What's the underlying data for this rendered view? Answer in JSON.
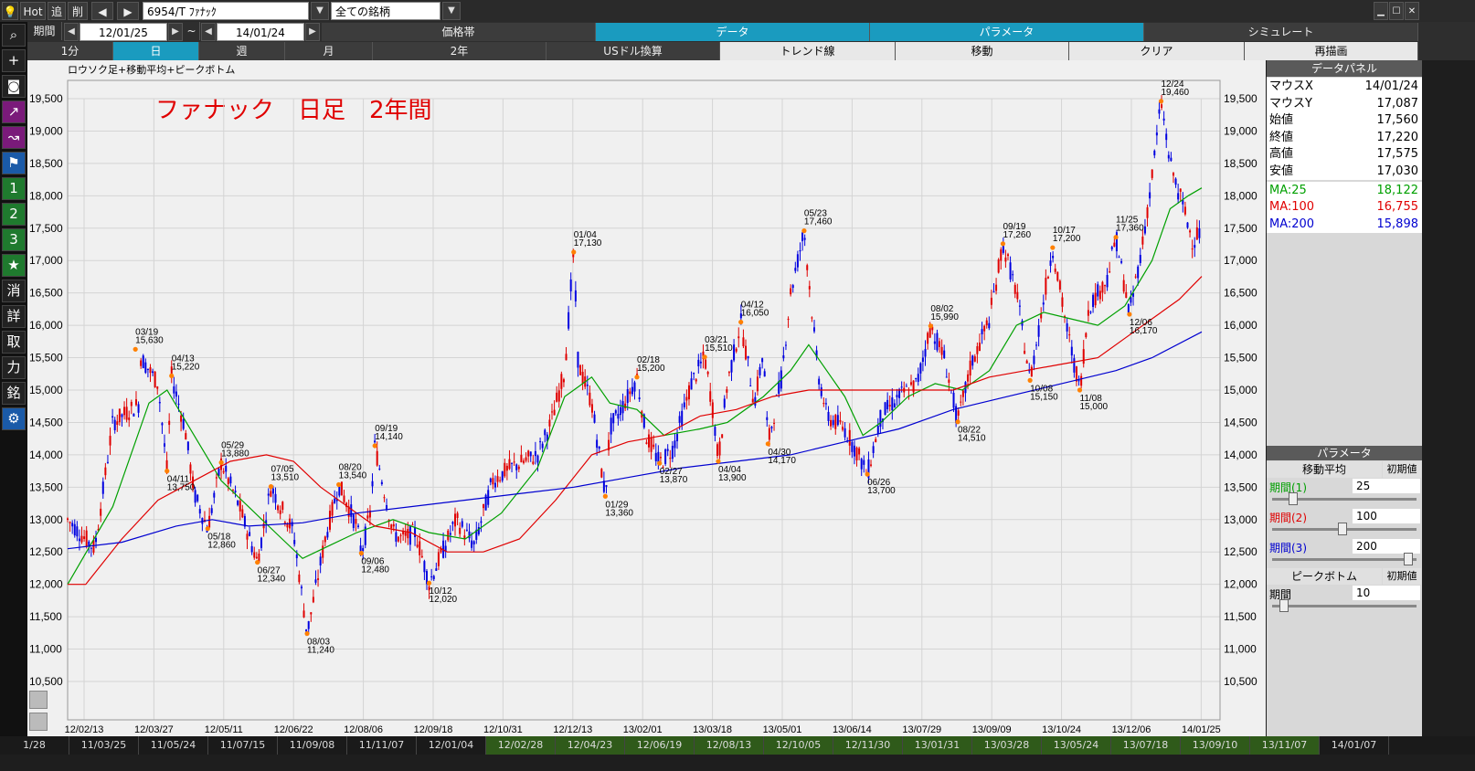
{
  "toolbar": {
    "hot_label": "Hot",
    "add_label": "追",
    "del_label": "削",
    "symbol_value": "6954/T ﾌｧﾅｯｸ",
    "universe_value": "全ての銘柄",
    "window_buttons": [
      "▁",
      "☐",
      "✕"
    ]
  },
  "period": {
    "label": "期間",
    "from": "12/01/25",
    "tilde": "~",
    "to": "14/01/24"
  },
  "mode_tabs": [
    {
      "label": "価格帯"
    },
    {
      "label": "データ"
    },
    {
      "label": "パラメータ"
    },
    {
      "label": "シミュレート"
    }
  ],
  "range_tabs": [
    {
      "label": "1分"
    },
    {
      "label": "日"
    },
    {
      "label": "週"
    },
    {
      "label": "月"
    },
    {
      "label": "2年"
    },
    {
      "label": "USドル換算"
    },
    {
      "label": "トレンド線"
    },
    {
      "label": "移動"
    },
    {
      "label": "クリア"
    },
    {
      "label": "再描画"
    }
  ],
  "left_tools": [
    "search-icon",
    "plus-icon",
    "camera-icon",
    "chart-line-icon",
    "chart-multi-icon",
    "flag-icon",
    "1",
    "2",
    "3",
    "★",
    "消",
    "詳",
    "取",
    "力",
    "銘",
    "gear-icon"
  ],
  "chart": {
    "subtitle": "ロウソク足+移動平均+ピークボトム",
    "title": "ファナック　日足　2年間"
  },
  "chart_data": {
    "type": "candlestick",
    "ylim": [
      10500,
      19500
    ],
    "yticks": [
      10500,
      11000,
      11500,
      12000,
      12500,
      13000,
      13500,
      14000,
      14500,
      15000,
      15500,
      16000,
      16500,
      17000,
      17500,
      18000,
      18500,
      19000,
      19500
    ],
    "ytick_labels": [
      "10,500",
      "11,000",
      "11,500",
      "12,000",
      "12,500",
      "13,000",
      "13,500",
      "14,000",
      "14,500",
      "15,000",
      "15,500",
      "16,000",
      "16,500",
      "17,000",
      "17,500",
      "18,000",
      "18,500",
      "19,000",
      "19,500"
    ],
    "xtick_labels": [
      "12/02/13",
      "12/03/27",
      "12/05/11",
      "12/06/22",
      "12/08/06",
      "12/09/18",
      "12/10/31",
      "12/12/13",
      "13/02/01",
      "13/03/18",
      "13/05/01",
      "13/06/14",
      "13/07/29",
      "13/09/09",
      "13/10/24",
      "13/12/06",
      "14/01/25"
    ],
    "price_path": [
      [
        0,
        13000
      ],
      [
        0.03,
        12550
      ],
      [
        0.05,
        14500
      ],
      [
        0.08,
        14800
      ],
      [
        0.075,
        15630
      ],
      [
        0.1,
        15100
      ],
      [
        0.11,
        13750
      ],
      [
        0.115,
        15220
      ],
      [
        0.13,
        14400
      ],
      [
        0.14,
        13400
      ],
      [
        0.155,
        12860
      ],
      [
        0.17,
        13880
      ],
      [
        0.19,
        13200
      ],
      [
        0.21,
        12340
      ],
      [
        0.225,
        13510
      ],
      [
        0.25,
        12800
      ],
      [
        0.265,
        11240
      ],
      [
        0.285,
        12700
      ],
      [
        0.3,
        13540
      ],
      [
        0.32,
        12900
      ],
      [
        0.325,
        12480
      ],
      [
        0.335,
        13100
      ],
      [
        0.34,
        14140
      ],
      [
        0.36,
        12800
      ],
      [
        0.37,
        12700
      ],
      [
        0.385,
        12800
      ],
      [
        0.4,
        12020
      ],
      [
        0.43,
        13000
      ],
      [
        0.45,
        12600
      ],
      [
        0.47,
        13600
      ],
      [
        0.49,
        13800
      ],
      [
        0.52,
        14000
      ],
      [
        0.535,
        14500
      ],
      [
        0.55,
        15300
      ],
      [
        0.56,
        17130
      ],
      [
        0.565,
        15400
      ],
      [
        0.58,
        14800
      ],
      [
        0.595,
        13360
      ],
      [
        0.6,
        14400
      ],
      [
        0.62,
        14900
      ],
      [
        0.63,
        15200
      ],
      [
        0.64,
        14300
      ],
      [
        0.655,
        13870
      ],
      [
        0.67,
        14100
      ],
      [
        0.69,
        15100
      ],
      [
        0.705,
        15510
      ],
      [
        0.715,
        14600
      ],
      [
        0.72,
        13900
      ],
      [
        0.73,
        15100
      ],
      [
        0.745,
        16050
      ],
      [
        0.76,
        14800
      ],
      [
        0.77,
        15600
      ],
      [
        0.775,
        14170
      ],
      [
        0.79,
        15200
      ],
      [
        0.8,
        16500
      ],
      [
        0.815,
        17460
      ],
      [
        0.83,
        15300
      ],
      [
        0.84,
        14600
      ],
      [
        0.86,
        14400
      ],
      [
        0.875,
        14000
      ],
      [
        0.885,
        13700
      ],
      [
        0.9,
        14600
      ],
      [
        0.92,
        14900
      ],
      [
        0.94,
        15100
      ],
      [
        0.955,
        15990
      ],
      [
        0.97,
        15500
      ],
      [
        0.985,
        14510
      ],
      [
        1.0,
        15400
      ],
      [
        1.02,
        16100
      ],
      [
        1.035,
        17260
      ],
      [
        1.05,
        16500
      ],
      [
        1.065,
        15150
      ],
      [
        1.08,
        16400
      ],
      [
        1.09,
        17200
      ],
      [
        1.105,
        16000
      ],
      [
        1.12,
        15000
      ],
      [
        1.13,
        16300
      ],
      [
        1.15,
        16700
      ],
      [
        1.16,
        17360
      ],
      [
        1.175,
        16170
      ],
      [
        1.19,
        17300
      ],
      [
        1.2,
        18300
      ],
      [
        1.21,
        19460
      ],
      [
        1.22,
        18500
      ],
      [
        1.235,
        17800
      ],
      [
        1.245,
        17300
      ],
      [
        1.255,
        17500
      ]
    ],
    "ma": [
      {
        "name": "MA:25",
        "color": "#00a000",
        "points": [
          [
            0,
            12000
          ],
          [
            0.05,
            13200
          ],
          [
            0.09,
            14800
          ],
          [
            0.11,
            15000
          ],
          [
            0.14,
            14300
          ],
          [
            0.17,
            13600
          ],
          [
            0.2,
            13200
          ],
          [
            0.23,
            12800
          ],
          [
            0.26,
            12400
          ],
          [
            0.29,
            12600
          ],
          [
            0.32,
            12800
          ],
          [
            0.36,
            13000
          ],
          [
            0.4,
            12800
          ],
          [
            0.44,
            12700
          ],
          [
            0.48,
            13100
          ],
          [
            0.52,
            13800
          ],
          [
            0.55,
            14900
          ],
          [
            0.58,
            15200
          ],
          [
            0.6,
            14800
          ],
          [
            0.63,
            14700
          ],
          [
            0.66,
            14300
          ],
          [
            0.7,
            14400
          ],
          [
            0.73,
            14500
          ],
          [
            0.77,
            14900
          ],
          [
            0.8,
            15300
          ],
          [
            0.82,
            15700
          ],
          [
            0.84,
            15300
          ],
          [
            0.86,
            14900
          ],
          [
            0.88,
            14300
          ],
          [
            0.9,
            14500
          ],
          [
            0.93,
            14900
          ],
          [
            0.96,
            15100
          ],
          [
            0.99,
            15000
          ],
          [
            1.02,
            15300
          ],
          [
            1.05,
            16000
          ],
          [
            1.08,
            16200
          ],
          [
            1.11,
            16100
          ],
          [
            1.14,
            16000
          ],
          [
            1.17,
            16300
          ],
          [
            1.2,
            17000
          ],
          [
            1.22,
            17800
          ],
          [
            1.24,
            18000
          ],
          [
            1.255,
            18122
          ]
        ]
      },
      {
        "name": "MA:100",
        "color": "#e00000",
        "points": [
          [
            0,
            12000
          ],
          [
            0.02,
            12000
          ],
          [
            0.06,
            12700
          ],
          [
            0.1,
            13300
          ],
          [
            0.14,
            13600
          ],
          [
            0.18,
            13900
          ],
          [
            0.22,
            14000
          ],
          [
            0.25,
            13900
          ],
          [
            0.28,
            13500
          ],
          [
            0.31,
            13200
          ],
          [
            0.34,
            12900
          ],
          [
            0.38,
            12800
          ],
          [
            0.42,
            12500
          ],
          [
            0.46,
            12500
          ],
          [
            0.5,
            12700
          ],
          [
            0.54,
            13300
          ],
          [
            0.58,
            14000
          ],
          [
            0.62,
            14200
          ],
          [
            0.66,
            14300
          ],
          [
            0.7,
            14600
          ],
          [
            0.74,
            14700
          ],
          [
            0.78,
            14900
          ],
          [
            0.82,
            15000
          ],
          [
            0.86,
            15000
          ],
          [
            0.9,
            15000
          ],
          [
            0.94,
            15000
          ],
          [
            0.98,
            15000
          ],
          [
            1.02,
            15200
          ],
          [
            1.06,
            15300
          ],
          [
            1.1,
            15400
          ],
          [
            1.14,
            15500
          ],
          [
            1.17,
            15800
          ],
          [
            1.2,
            16100
          ],
          [
            1.23,
            16400
          ],
          [
            1.255,
            16755
          ]
        ]
      },
      {
        "name": "MA:200",
        "color": "#0000d0",
        "points": [
          [
            0,
            12550
          ],
          [
            0.06,
            12650
          ],
          [
            0.12,
            12900
          ],
          [
            0.16,
            13000
          ],
          [
            0.2,
            12900
          ],
          [
            0.26,
            12950
          ],
          [
            0.32,
            13100
          ],
          [
            0.38,
            13200
          ],
          [
            0.44,
            13300
          ],
          [
            0.5,
            13400
          ],
          [
            0.56,
            13500
          ],
          [
            0.62,
            13650
          ],
          [
            0.68,
            13800
          ],
          [
            0.74,
            13900
          ],
          [
            0.8,
            14000
          ],
          [
            0.86,
            14200
          ],
          [
            0.92,
            14400
          ],
          [
            0.98,
            14700
          ],
          [
            1.04,
            14900
          ],
          [
            1.1,
            15100
          ],
          [
            1.16,
            15300
          ],
          [
            1.2,
            15500
          ],
          [
            1.255,
            15898
          ]
        ]
      }
    ],
    "peaks": [
      {
        "date": "03/19",
        "price": "15,630",
        "x": 0.075,
        "y": 15630,
        "top": true
      },
      {
        "date": "04/13",
        "price": "15,220",
        "x": 0.115,
        "y": 15220,
        "top": true
      },
      {
        "date": "04/11",
        "price": "13,750",
        "x": 0.11,
        "y": 13750,
        "top": false
      },
      {
        "date": "05/29",
        "price": "13,880",
        "x": 0.17,
        "y": 13880,
        "top": true
      },
      {
        "date": "05/18",
        "price": "12,860",
        "x": 0.155,
        "y": 12860,
        "top": false
      },
      {
        "date": "06/27",
        "price": "12,340",
        "x": 0.21,
        "y": 12340,
        "top": false
      },
      {
        "date": "07/05",
        "price": "13,510",
        "x": 0.225,
        "y": 13510,
        "top": true
      },
      {
        "date": "08/03",
        "price": "11,240",
        "x": 0.265,
        "y": 11240,
        "top": false
      },
      {
        "date": "08/20",
        "price": "13,540",
        "x": 0.3,
        "y": 13540,
        "top": true
      },
      {
        "date": "09/06",
        "price": "12,480",
        "x": 0.325,
        "y": 12480,
        "top": false
      },
      {
        "date": "09/19",
        "price": "14,140",
        "x": 0.34,
        "y": 14140,
        "top": true
      },
      {
        "date": "10/12",
        "price": "12,020",
        "x": 0.4,
        "y": 12020,
        "top": false
      },
      {
        "date": "01/04",
        "price": "17,130",
        "x": 0.56,
        "y": 17130,
        "top": true
      },
      {
        "date": "01/29",
        "price": "13,360",
        "x": 0.595,
        "y": 13360,
        "top": false
      },
      {
        "date": "02/18",
        "price": "15,200",
        "x": 0.63,
        "y": 15200,
        "top": true
      },
      {
        "date": "02/27",
        "price": "13,870",
        "x": 0.655,
        "y": 13870,
        "top": false
      },
      {
        "date": "03/21",
        "price": "15,510",
        "x": 0.705,
        "y": 15510,
        "top": true
      },
      {
        "date": "04/04",
        "price": "13,900",
        "x": 0.72,
        "y": 13900,
        "top": false
      },
      {
        "date": "04/12",
        "price": "16,050",
        "x": 0.745,
        "y": 16050,
        "top": true
      },
      {
        "date": "04/30",
        "price": "14,170",
        "x": 0.775,
        "y": 14170,
        "top": false
      },
      {
        "date": "05/23",
        "price": "17,460",
        "x": 0.815,
        "y": 17460,
        "top": true
      },
      {
        "date": "06/26",
        "price": "13,700",
        "x": 0.885,
        "y": 13700,
        "top": false
      },
      {
        "date": "08/02",
        "price": "15,990",
        "x": 0.955,
        "y": 15990,
        "top": true
      },
      {
        "date": "08/22",
        "price": "14,510",
        "x": 0.985,
        "y": 14510,
        "top": false
      },
      {
        "date": "09/19",
        "price": "17,260",
        "x": 1.035,
        "y": 17260,
        "top": true
      },
      {
        "date": "10/08",
        "price": "15,150",
        "x": 1.065,
        "y": 15150,
        "top": false
      },
      {
        "date": "10/17",
        "price": "17,200",
        "x": 1.09,
        "y": 17200,
        "top": true
      },
      {
        "date": "11/08",
        "price": "15,000",
        "x": 1.12,
        "y": 15000,
        "top": false
      },
      {
        "date": "11/25",
        "price": "17,360",
        "x": 1.16,
        "y": 17360,
        "top": true
      },
      {
        "date": "12/06",
        "price": "16,170",
        "x": 1.175,
        "y": 16170,
        "top": false
      },
      {
        "date": "12/24",
        "price": "19,460",
        "x": 1.21,
        "y": 19460,
        "top": true
      }
    ]
  },
  "data_panel": {
    "title": "データパネル",
    "rows": [
      {
        "k": "マウスX",
        "v": "14/01/24",
        "color": "#000"
      },
      {
        "k": "マウスY",
        "v": "17,087",
        "color": "#000"
      },
      {
        "k": "始値",
        "v": "17,560",
        "color": "#000"
      },
      {
        "k": "終値",
        "v": "17,220",
        "color": "#000"
      },
      {
        "k": "高値",
        "v": "17,575",
        "color": "#000"
      },
      {
        "k": "安値",
        "v": "17,030",
        "color": "#000"
      },
      {
        "k": "MA:25",
        "v": "18,122",
        "color": "#00a000"
      },
      {
        "k": "MA:100",
        "v": "16,755",
        "color": "#e00000"
      },
      {
        "k": "MA:200",
        "v": "15,898",
        "color": "#0000d0"
      }
    ]
  },
  "param_panel": {
    "title": "パラメータ",
    "ma_section": "移動平均",
    "reset": "初期値",
    "periods": [
      {
        "label": "期間(1)",
        "value": "25",
        "color": "#00a000",
        "knob": 0.12
      },
      {
        "label": "期間(2)",
        "value": "100",
        "color": "#e00000",
        "knob": 0.48
      },
      {
        "label": "期間(3)",
        "value": "200",
        "color": "#0000d0",
        "knob": 0.96
      }
    ],
    "pb_section": "ピークボトム",
    "pb_reset": "初期値",
    "pb_label": "期間",
    "pb_value": "10",
    "pb_knob": 0.05
  },
  "bottom_dates": [
    "1/28",
    "11/03/25",
    "11/05/24",
    "11/07/15",
    "11/09/08",
    "11/11/07",
    "12/01/04",
    "12/02/28",
    "12/04/23",
    "12/06/19",
    "12/08/13",
    "12/10/05",
    "12/11/30",
    "13/01/31",
    "13/03/28",
    "13/05/24",
    "13/07/18",
    "13/09/10",
    "13/11/07",
    "14/01/07"
  ]
}
